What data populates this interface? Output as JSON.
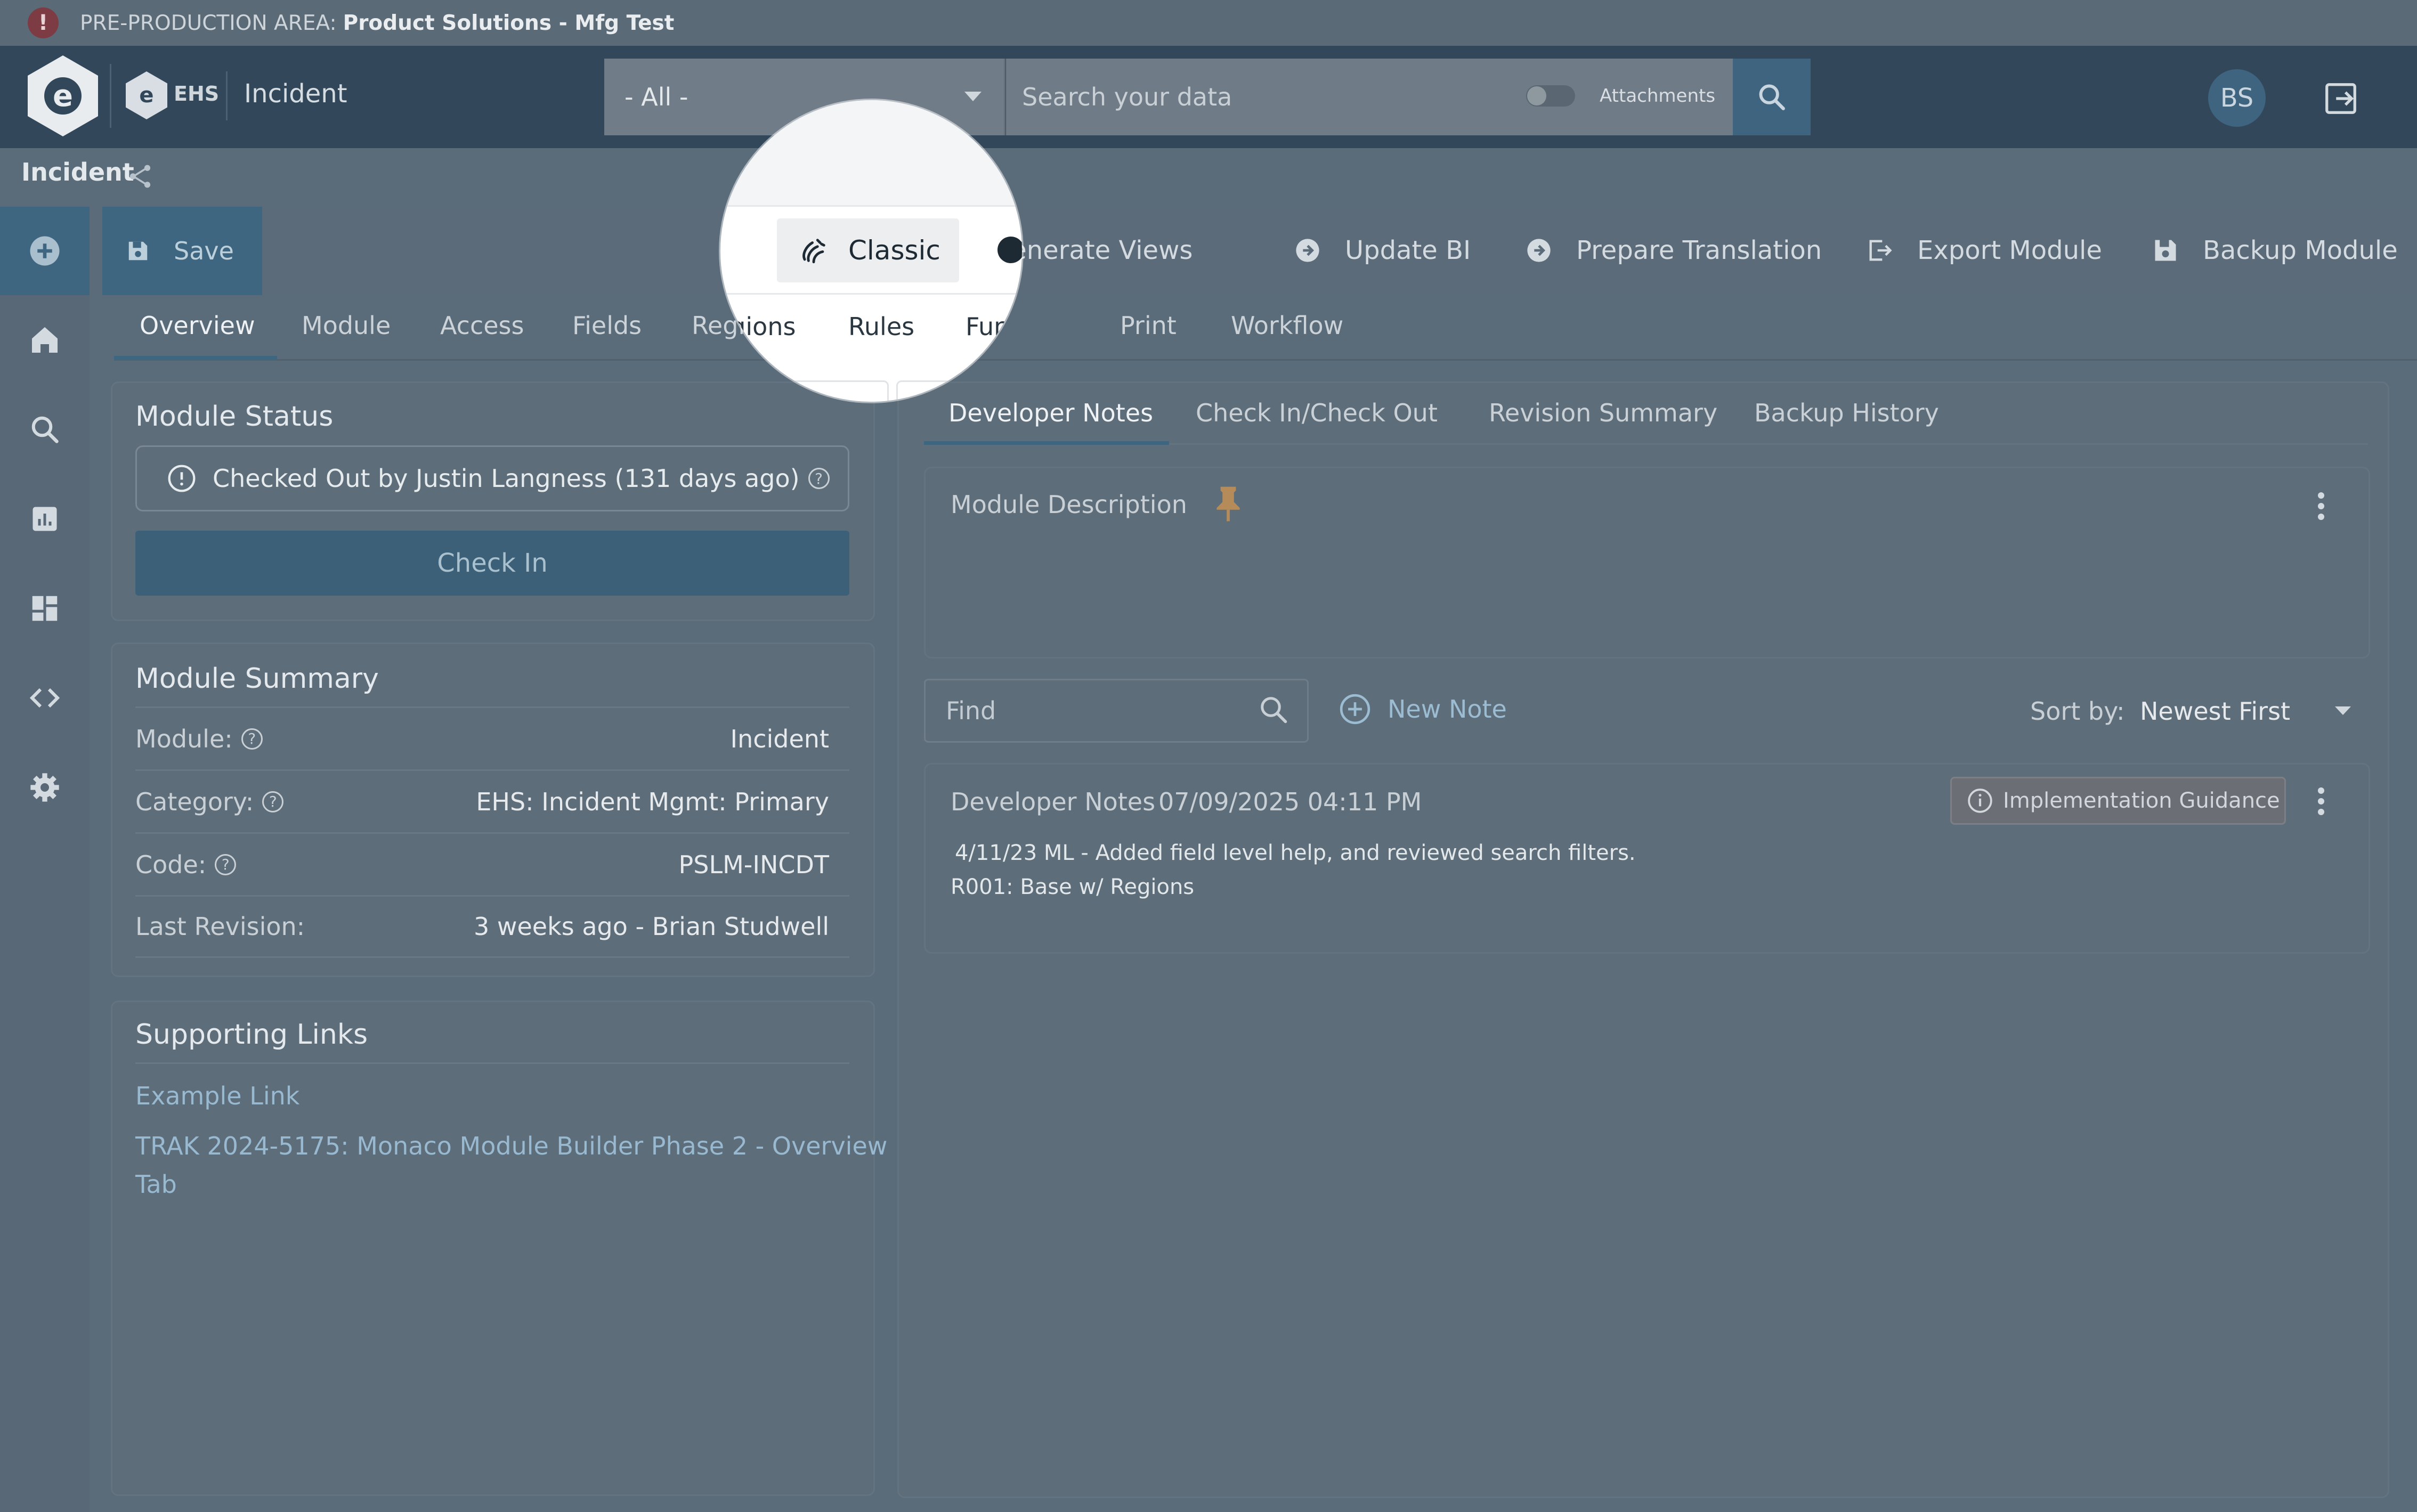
{
  "banner": {
    "prefix": "PRE-PRODUCTION AREA:",
    "env": "Product Solutions - Mfg Test",
    "alert_glyph": "!"
  },
  "header": {
    "logo_glyph": "e",
    "ehs_glyph": "e",
    "app_label": "EHS",
    "title": "Incident",
    "scope_value": "- All -",
    "search_placeholder": "Search your data",
    "attachments_label": "Attachments",
    "avatar_initials": "BS"
  },
  "breadcrumb": {
    "title": "Incident"
  },
  "toolbar": {
    "save_label": "Save",
    "classic_label": "Classic",
    "generate_views_label": "Generate Views",
    "update_bi_label": "Update BI",
    "prepare_translation_label": "Prepare Translation",
    "export_module_label": "Export Module",
    "backup_module_label": "Backup Module"
  },
  "tabs": [
    "Overview",
    "Module",
    "Access",
    "Fields",
    "Regions",
    "Rules",
    "Functions",
    "Print",
    "Workflow"
  ],
  "module_status": {
    "title": "Module Status",
    "status_text": "Checked Out by Justin Langness (131 days ago)",
    "check_in_label": "Check In"
  },
  "module_summary": {
    "title": "Module Summary",
    "rows": [
      {
        "label": "Module:",
        "value": "Incident"
      },
      {
        "label": "Category:",
        "value": "EHS: Incident Mgmt: Primary"
      },
      {
        "label": "Code:",
        "value": "PSLM-INCDT"
      },
      {
        "label": "Last Revision:",
        "value": "3 weeks ago - Brian Studwell"
      }
    ]
  },
  "supporting_links": {
    "title": "Supporting Links",
    "links": [
      "Example Link",
      "TRAK 2024-5175: Monaco Module Builder Phase 2 - Overview",
      "Tab"
    ]
  },
  "right_tabs": [
    "Developer Notes",
    "Check In/Check Out",
    "Revision Summary",
    "Backup History"
  ],
  "module_description": {
    "label": "Module Description"
  },
  "notes_toolbar": {
    "find_placeholder": "Find",
    "new_note_label": "New Note",
    "sort_label": "Sort by:",
    "sort_value": "Newest First"
  },
  "note": {
    "title": "Developer Notes",
    "date": "07/09/2025 04:11 PM",
    "badge": "Implementation Guidance",
    "line1": "4/11/23 ML - Added field level help, and reviewed search filters.",
    "line2": "R001: Base w/ Regions"
  },
  "colors": {
    "header_bg": "#32485a",
    "accent": "#3f6680",
    "overlay_bg": "#5a6b79"
  },
  "icons": [
    "alert-icon",
    "search-icon",
    "logout-icon",
    "share-icon",
    "plus-circle-icon",
    "home-icon",
    "chart-icon",
    "dashboard-icon",
    "code-icon",
    "gear-icon",
    "save-icon",
    "classic-icon",
    "arrow-circle-icon",
    "export-icon",
    "info-icon",
    "help-icon",
    "pin-icon",
    "kebab-icon",
    "caret-down-icon"
  ]
}
